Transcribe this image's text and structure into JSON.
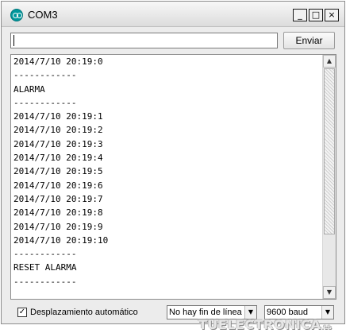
{
  "window": {
    "title": "COM3",
    "controls": {
      "minimize": "_",
      "maximize": "□",
      "close": "×"
    }
  },
  "send": {
    "input_value": "",
    "button_label": "Enviar"
  },
  "output": {
    "lines": [
      "2014/7/10 20:19:0",
      "------------",
      "ALARMA",
      "------------",
      "2014/7/10 20:19:1",
      "2014/7/10 20:19:2",
      "2014/7/10 20:19:3",
      "2014/7/10 20:19:4",
      "2014/7/10 20:19:5",
      "2014/7/10 20:19:6",
      "2014/7/10 20:19:7",
      "2014/7/10 20:19:8",
      "2014/7/10 20:19:9",
      "2014/7/10 20:19:10",
      "------------",
      "RESET ALARMA",
      "------------"
    ]
  },
  "footer": {
    "autoscroll_label": "Desplazamiento automático",
    "autoscroll_checked": true,
    "line_ending_value": "No hay fin de línea",
    "baud_value": "9600 baud"
  },
  "watermark": {
    "text": "TUELECTRONICA",
    "tld": ".es"
  },
  "colors": {
    "arduino_teal": "#00979c",
    "window_bg": "#ececec"
  },
  "icons": {
    "app": "arduino-icon",
    "scroll_up": "arrow-up-icon",
    "scroll_down": "arrow-down-icon",
    "dropdown": "chevron-down-icon",
    "check": "check-icon"
  }
}
